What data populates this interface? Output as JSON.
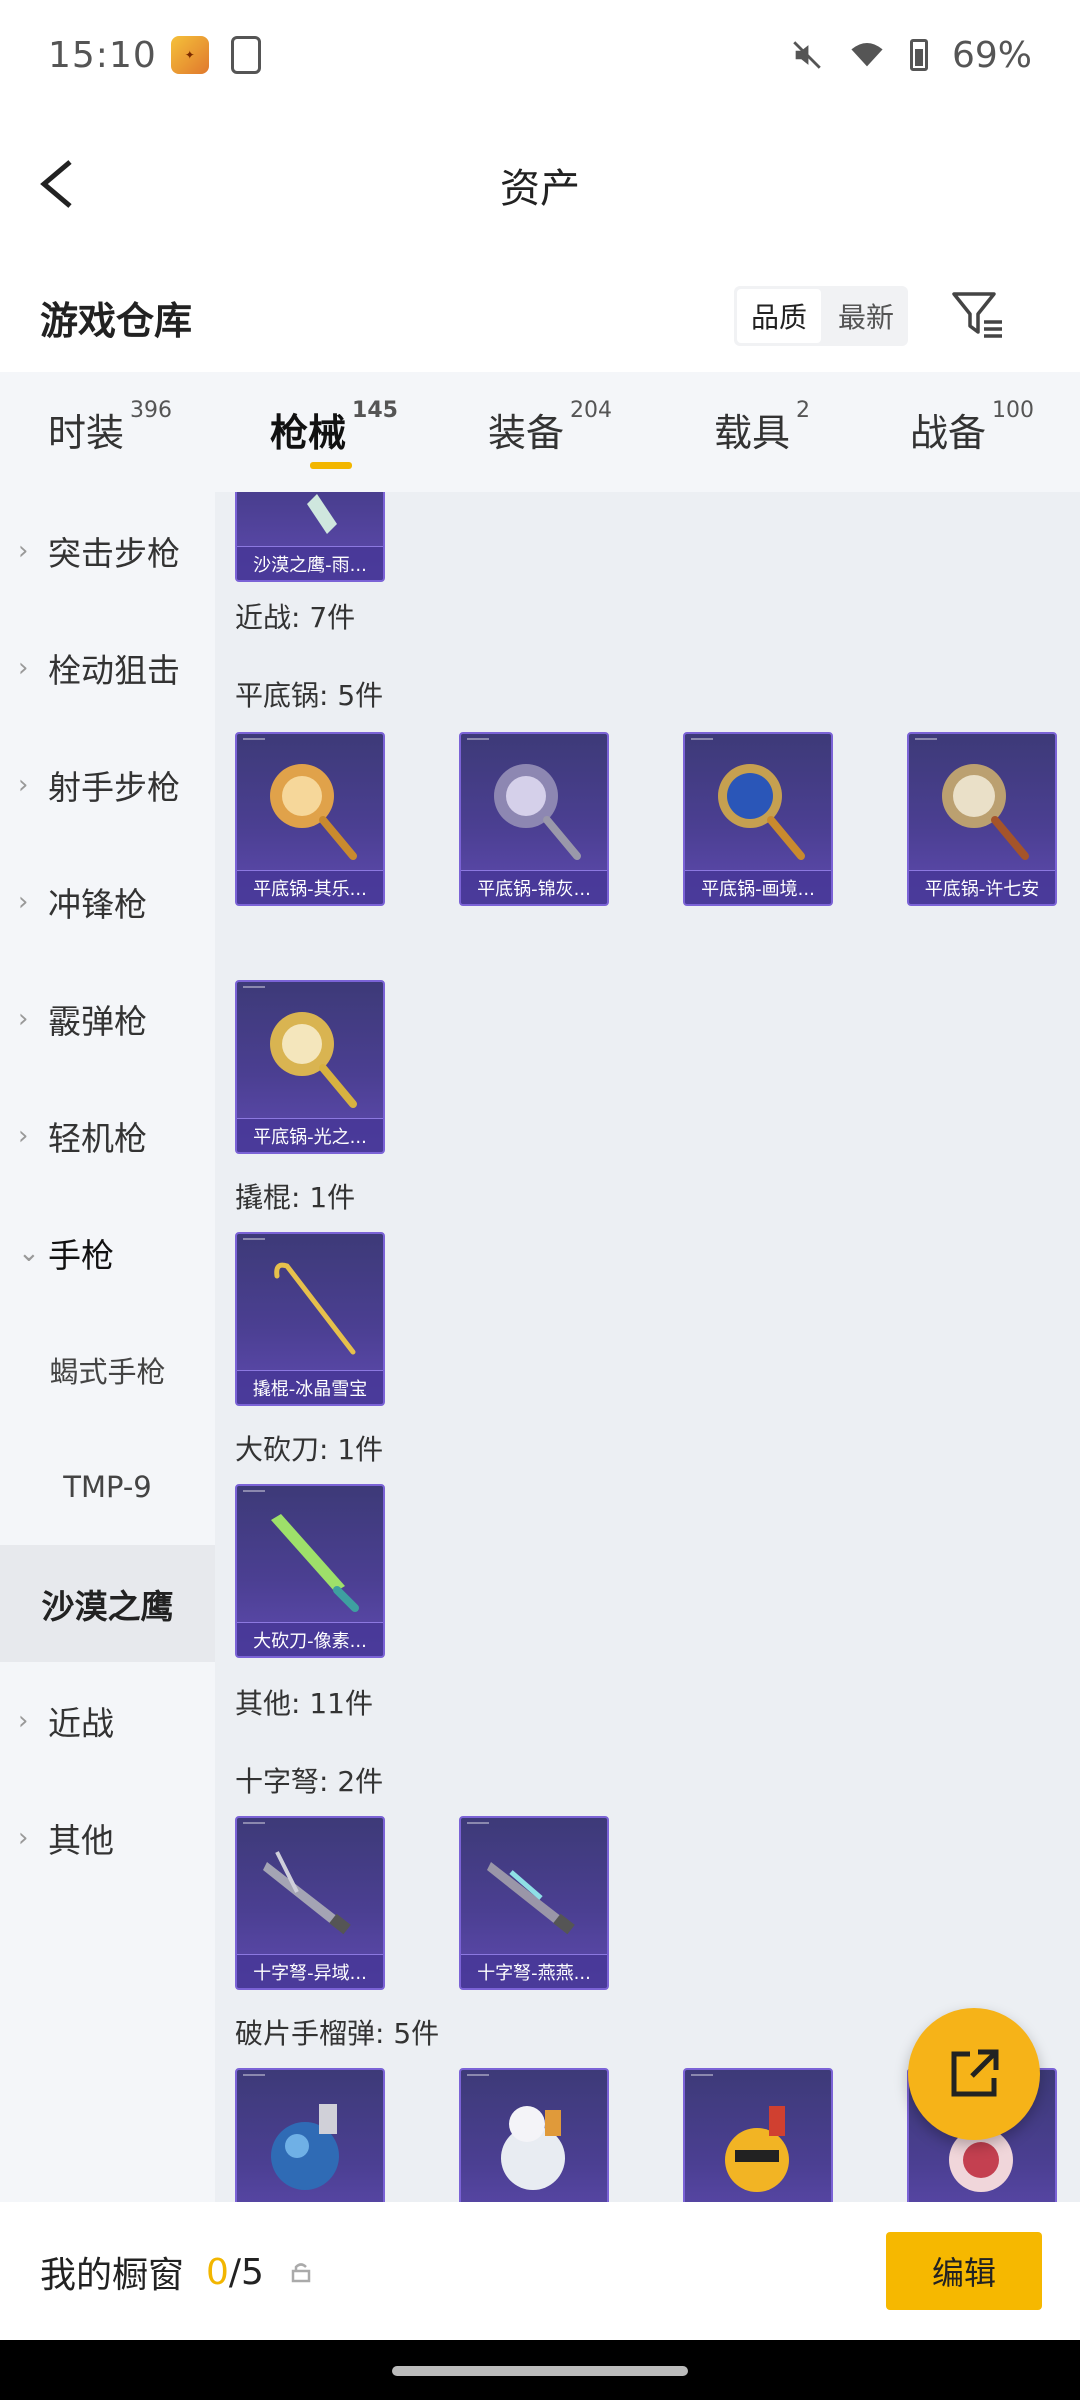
{
  "status": {
    "time": "15:10",
    "battery": "69%"
  },
  "header": {
    "title": "资产"
  },
  "warehouse": {
    "title": "游戏仓库",
    "sort": [
      "品质",
      "最新"
    ]
  },
  "tabs": [
    {
      "label": "时装",
      "count": "396"
    },
    {
      "label": "枪械",
      "count": "145"
    },
    {
      "label": "装备",
      "count": "204"
    },
    {
      "label": "载具",
      "count": "2"
    },
    {
      "label": "战备",
      "count": "100"
    }
  ],
  "sidebar": {
    "items": [
      "突击步枪",
      "栓动狙击",
      "射手步枪",
      "冲锋枪",
      "霰弹枪",
      "轻机枪",
      "手枪",
      "蝎式手枪",
      "TMP-9",
      "沙漠之鹰",
      "近战",
      "其他"
    ]
  },
  "content": {
    "top_card": "沙漠之鹰-雨...",
    "sections": {
      "melee": "近战: 7件",
      "pan": "平底锅: 5件",
      "crowbar": "撬棍: 1件",
      "machete": "大砍刀: 1件",
      "other": "其他: 11件",
      "crossbow": "十字弩: 2件",
      "grenade": "破片手榴弹: 5件"
    },
    "pans": [
      "平底锅-其乐...",
      "平底锅-锦灰...",
      "平底锅-画境...",
      "平底锅-许七安",
      "平底锅-光之..."
    ],
    "crowbars": [
      "撬棍-冰晶雪宝"
    ],
    "machetes": [
      "大砍刀-像素..."
    ],
    "crossbows": [
      "十字弩-异域...",
      "十字弩-燕燕..."
    ]
  },
  "bottom": {
    "label": "我的橱窗",
    "count_current": "0",
    "count_sep": "/5",
    "edit": "编辑"
  },
  "colors": {
    "accent": "#f6b800",
    "card": "#4b3f92"
  }
}
